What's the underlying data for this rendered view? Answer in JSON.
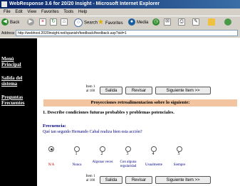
{
  "window": {
    "title": "WebResponse 3.6 for 20/20 Insight - Microsoft Internet Explorer"
  },
  "menu": [
    "File",
    "Edit",
    "View",
    "Favorites",
    "Tools",
    "Help"
  ],
  "toolbar": {
    "back": "Back",
    "search": "Search",
    "favorites": "Favorites",
    "media": "Media"
  },
  "address": {
    "label": "Address",
    "url": "http://webhost.2020insight.net/spanish/feedback/feedback.asp?sid=1"
  },
  "sidebar": [
    "Menú Principal",
    "Salida del sistema",
    "Preguntas Frecuentes"
  ],
  "nav": {
    "item_line1": "Item 1",
    "item_line2": "al 100",
    "salida": "Salida",
    "revisar": "Revisar",
    "siguiente": "Siguiente Item >>"
  },
  "section_title": "Proyecciones retroalimentacion sobre lo siguiente:",
  "question": "1. Describe condiciones futuras probables y problemas potenciales.",
  "frequency": {
    "label": "Frecuencia:",
    "question": "Qué tan seguido Hernando Cabal realiza bien esta acción?"
  },
  "scale": {
    "numbers": [
      "1",
      "2",
      "3",
      "4",
      "5"
    ],
    "labels": [
      "N/A",
      "Nunca",
      "Algunas veces",
      "Con alguna regularidad",
      "Usualmente",
      "Siempre"
    ],
    "selected_index": 0
  }
}
